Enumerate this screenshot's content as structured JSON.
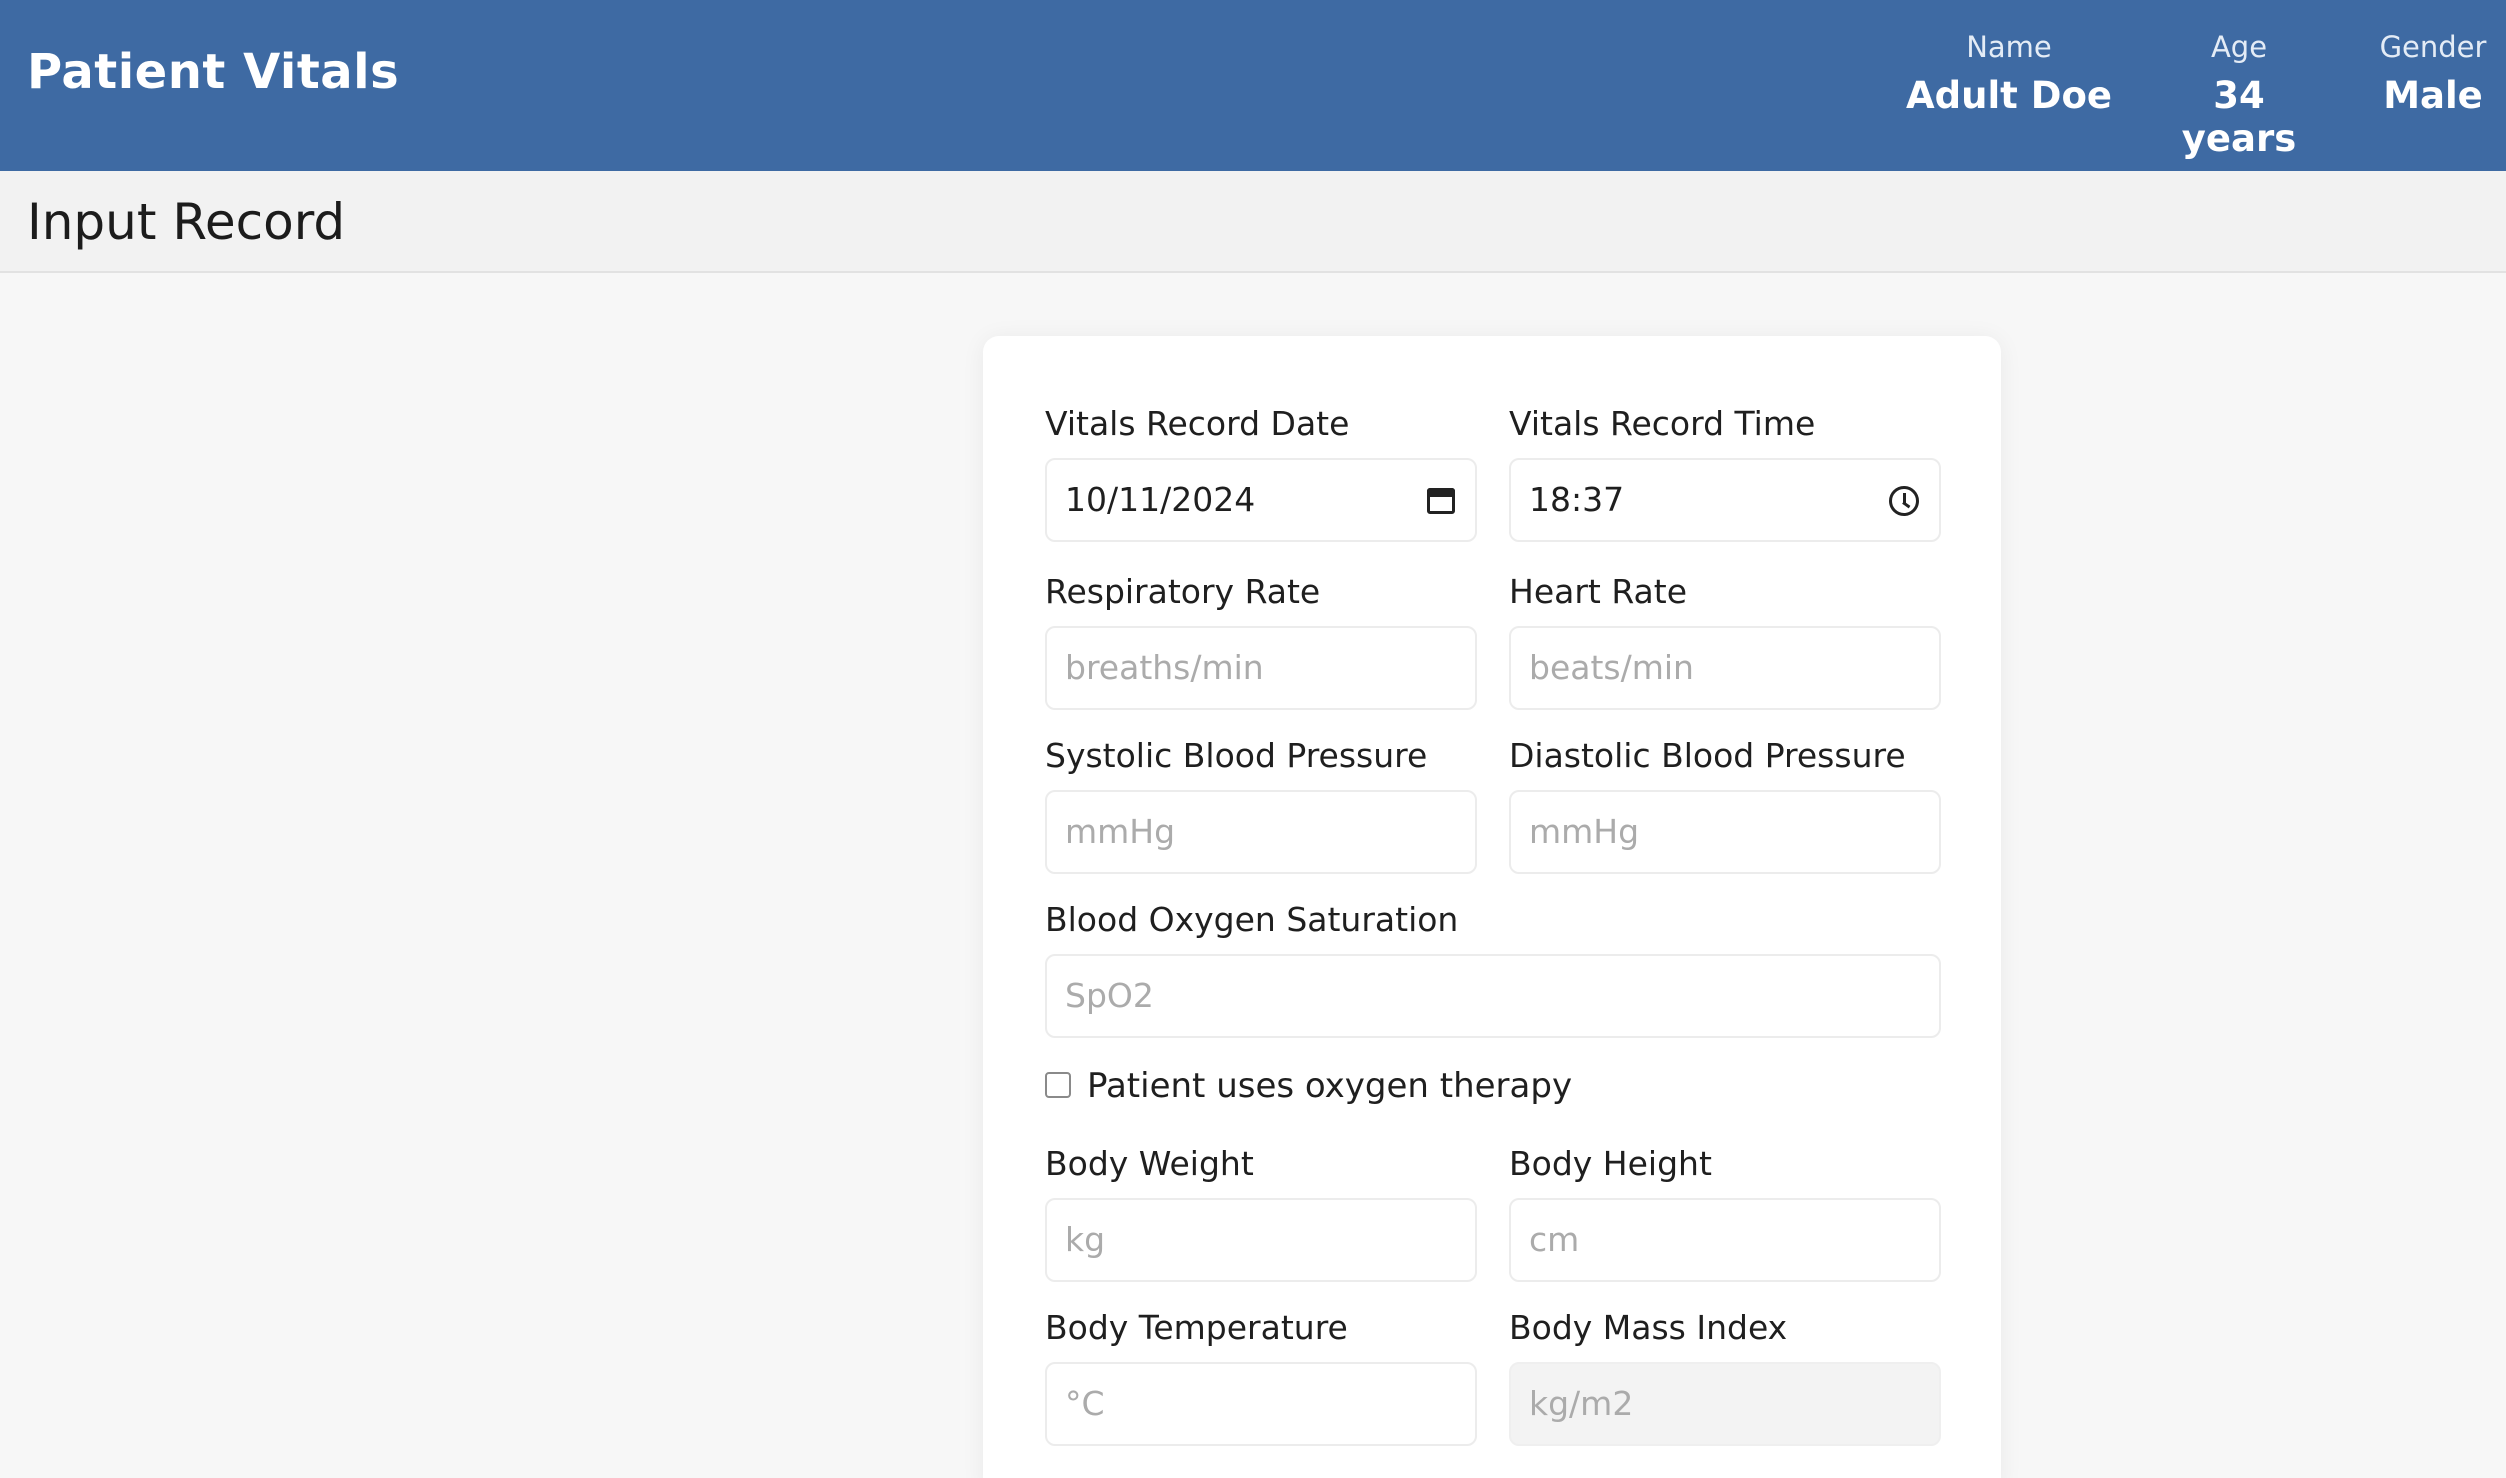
{
  "app": {
    "title": "Patient Vitals"
  },
  "patient": {
    "name_label": "Name",
    "name": "Adult Doe",
    "age_label": "Age",
    "age": "34 years",
    "gender_label": "Gender",
    "gender": "Male"
  },
  "page": {
    "heading": "Input Record"
  },
  "form": {
    "record_date": {
      "label": "Vitals Record Date",
      "value": "10/11/2024",
      "icon": "calendar-icon"
    },
    "record_time": {
      "label": "Vitals Record Time",
      "value": "18:37",
      "icon": "clock-icon"
    },
    "respiratory_rate": {
      "label": "Respiratory Rate",
      "placeholder": "breaths/min"
    },
    "heart_rate": {
      "label": "Heart Rate",
      "placeholder": "beats/min"
    },
    "systolic_bp": {
      "label": "Systolic Blood Pressure",
      "placeholder": "mmHg"
    },
    "diastolic_bp": {
      "label": "Diastolic Blood Pressure",
      "placeholder": "mmHg"
    },
    "spo2": {
      "label": "Blood Oxygen Saturation",
      "placeholder": "SpO2"
    },
    "oxygen_therapy": {
      "label": "Patient uses oxygen therapy",
      "checked": false
    },
    "body_weight": {
      "label": "Body Weight",
      "placeholder": "kg"
    },
    "body_height": {
      "label": "Body Height",
      "placeholder": "cm"
    },
    "body_temperature": {
      "label": "Body Temperature",
      "placeholder": "°C"
    },
    "bmi": {
      "label": "Body Mass Index",
      "placeholder": "kg/m2",
      "disabled": true
    }
  },
  "colors": {
    "header_bg": "#3e6aa3",
    "page_bg": "#f7f7f7",
    "card_bg": "#ffffff"
  }
}
